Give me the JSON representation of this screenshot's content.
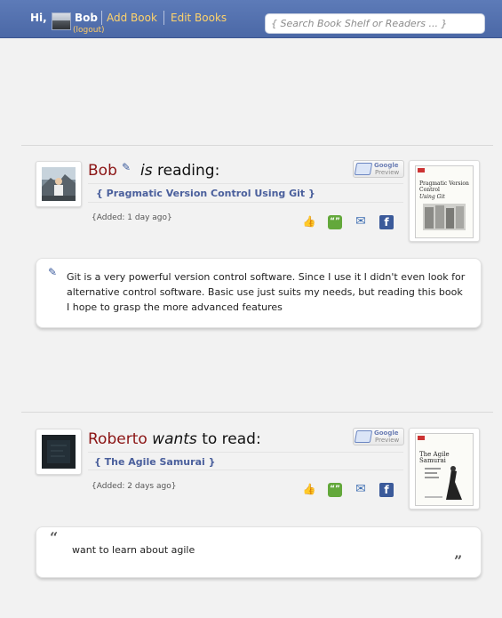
{
  "header": {
    "greeting": "Hi,",
    "username": "Bob",
    "logout": "(logout)",
    "add_book": "Add Book",
    "edit_books": "Edit Books",
    "search_placeholder": "{ Search Book Shelf or Readers ... }"
  },
  "feed": [
    {
      "user": "Bob",
      "verb": "is",
      "action_tail": " reading:",
      "book_title": "{ Pragmatic Version Control Using Git }",
      "added": "{Added: 1 day ago}",
      "google_preview": {
        "line1": "Google",
        "line2": "Preview"
      },
      "cover": {
        "title": "Pragmatic Version Control",
        "subtitle": "Using Git"
      },
      "comment": "Git is a very powerful version control software. Since I use it I didn't even look for alternative control software. Basic use just suits my needs, but reading this book I hope to grasp the more advanced features"
    },
    {
      "user": "Roberto",
      "verb": "wants",
      "action_tail": " to read:",
      "book_title": "{ The Agile Samurai }",
      "added": "{Added: 2 days ago}",
      "google_preview": {
        "line1": "Google",
        "line2": "Preview"
      },
      "cover": {
        "title": "The Agile Samurai"
      },
      "comment": "want to learn about agile",
      "quote_open": "“",
      "quote_close": "”"
    }
  ],
  "icons": {
    "like": "thumbs-up-icon",
    "comment": "comment-icon",
    "mail": "mail-icon",
    "facebook": "facebook-icon"
  },
  "colors": {
    "header_bg": "#5570ae",
    "username": "#8b1414",
    "link": "#ffd36b"
  }
}
